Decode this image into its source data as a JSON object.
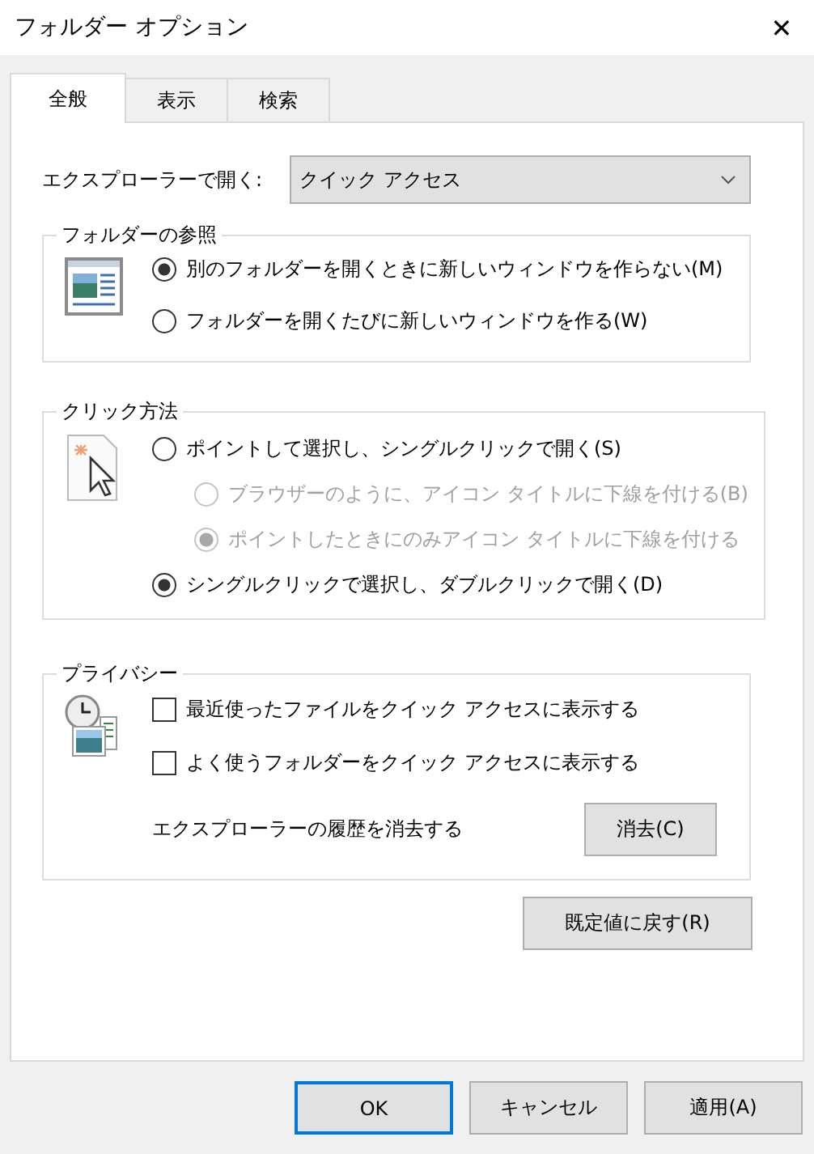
{
  "window": {
    "title": "フォルダー オプション",
    "close": "✕"
  },
  "tabs": [
    {
      "label": "全般",
      "selected": true
    },
    {
      "label": "表示",
      "selected": false
    },
    {
      "label": "検索",
      "selected": false
    }
  ],
  "open_in": {
    "label": "エクスプローラーで開く:",
    "value": "クイック アクセス"
  },
  "folder_browse": {
    "title": "フォルダーの参照",
    "options": [
      {
        "label": "別のフォルダーを開くときに新しいウィンドウを作らない(M)",
        "selected": true,
        "disabled": false
      },
      {
        "label": "フォルダーを開くたびに新しいウィンドウを作る(W)",
        "selected": false,
        "disabled": false
      }
    ]
  },
  "click_method": {
    "title": "クリック方法",
    "options": [
      {
        "label": "ポイントして選択し、シングルクリックで開く(S)",
        "selected": false,
        "disabled": false,
        "children": [
          {
            "label": "ブラウザーのように、アイコン タイトルに下線を付ける(B)",
            "selected": false,
            "disabled": true
          },
          {
            "label": "ポイントしたときにのみアイコン タイトルに下線を付ける",
            "selected": true,
            "disabled": true
          }
        ]
      },
      {
        "label": "シングルクリックで選択し、ダブルクリックで開く(D)",
        "selected": true,
        "disabled": false
      }
    ]
  },
  "privacy": {
    "title": "プライバシー",
    "checkboxes": [
      {
        "label": "最近使ったファイルをクイック アクセスに表示する",
        "checked": false
      },
      {
        "label": "よく使うフォルダーをクイック アクセスに表示する",
        "checked": false
      }
    ],
    "clear_label": "エクスプローラーの履歴を消去する",
    "clear_button": "消去(C)"
  },
  "restore_button": "既定値に戻す(R)",
  "buttons": [
    {
      "label": "OK",
      "default": true
    },
    {
      "label": "キャンセル",
      "default": false
    },
    {
      "label": "適用(A)",
      "default": false
    }
  ]
}
